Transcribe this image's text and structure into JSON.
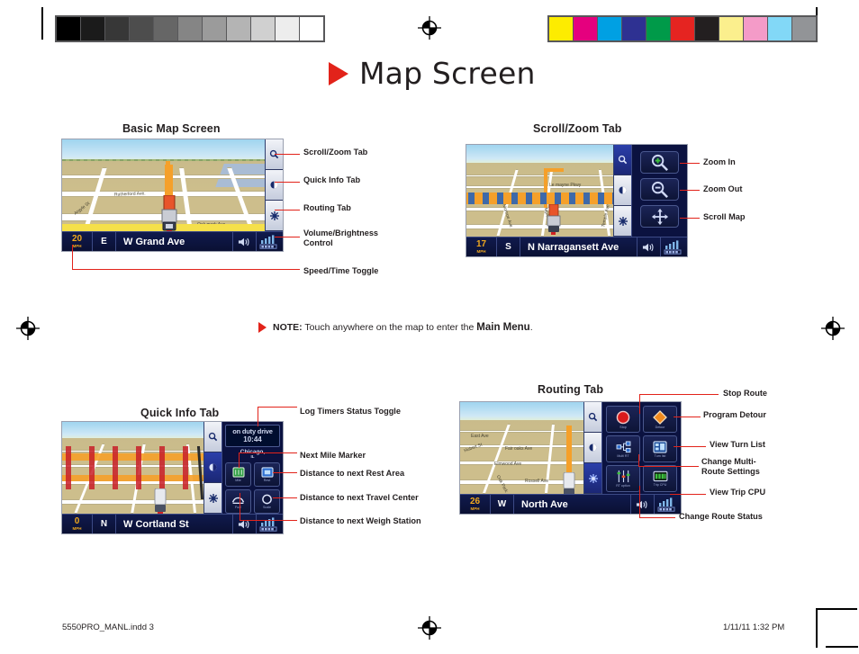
{
  "page": {
    "title": "Map Screen",
    "title_icon": "red-triangle-bullet"
  },
  "calibration": {
    "gray_label": "grayscale-calibration-strip",
    "gray_swatches": [
      "#000000",
      "#1b1b1b",
      "#373737",
      "#4d4d4d",
      "#666666",
      "#858585",
      "#9b9b9b",
      "#b4b4b4",
      "#d0d0d0",
      "#ededed",
      "#ffffff"
    ],
    "color_label": "color-calibration-strip",
    "color_swatches": [
      "#fdec00",
      "#e5007e",
      "#00a0e3",
      "#2e3192",
      "#009a49",
      "#e52421",
      "#231f20",
      "#fbef8d",
      "#f49bc8",
      "#82d8f7",
      "#929497"
    ]
  },
  "note": {
    "icon": "red-triangle-bullet",
    "label": "NOTE:",
    "text": " Touch anywhere on the map to enter the ",
    "emphasis": "Main Menu",
    "period": "."
  },
  "sections": {
    "basic": {
      "heading": "Basic Map Screen",
      "screen": {
        "speed": "20",
        "speed_unit": "MPH",
        "direction": "E",
        "street": "W Grand Ave",
        "road_labels": [
          "Rutherford Ave.",
          "Argyle St",
          "Oak mark Ave"
        ],
        "volume_icon": "speaker-icon",
        "signal_icon": "signal-bars-icon",
        "tabs": [
          {
            "name": "scroll-zoom-tab",
            "icon": "magnifier-icon",
            "active": false
          },
          {
            "name": "quick-info-tab",
            "icon": "info-circle-icon",
            "active": false
          },
          {
            "name": "routing-tab",
            "icon": "route-star-icon",
            "active": false
          }
        ]
      },
      "callouts": [
        {
          "id": "scroll-zoom-tab",
          "text": "Scroll/Zoom Tab"
        },
        {
          "id": "quick-info-tab",
          "text": "Quick Info Tab"
        },
        {
          "id": "routing-tab",
          "text": "Routing Tab"
        },
        {
          "id": "volume-brightness",
          "text": "Volume/Brightness Control"
        },
        {
          "id": "speed-time-toggle",
          "text": "Speed/Time Toggle"
        }
      ]
    },
    "scrollzoom": {
      "heading": "Scroll/Zoom Tab",
      "screen": {
        "speed": "17",
        "speed_unit": "MPH",
        "direction": "S",
        "street": "N Narragansett Ave",
        "road_labels": [
          "Le mayne Pkwy",
          "Monroe Ave",
          "Maple Ave",
          "Temple Ave",
          "Hilda"
        ],
        "volume_icon": "speaker-icon",
        "signal_icon": "signal-bars-icon",
        "tabs": [
          {
            "name": "scroll-zoom-tab",
            "icon": "magnifier-icon",
            "active": true
          },
          {
            "name": "quick-info-tab",
            "icon": "info-circle-icon",
            "active": false
          },
          {
            "name": "routing-tab",
            "icon": "route-star-icon",
            "active": false
          }
        ],
        "panel_buttons": [
          {
            "name": "zoom-in-button",
            "icon": "magnifier-plus-icon"
          },
          {
            "name": "zoom-out-button",
            "icon": "magnifier-minus-icon"
          },
          {
            "name": "scroll-map-button",
            "icon": "four-way-arrows-icon"
          }
        ]
      },
      "callouts": [
        {
          "id": "zoom-in",
          "text": "Zoom In"
        },
        {
          "id": "zoom-out",
          "text": "Zoom Out"
        },
        {
          "id": "scroll-map",
          "text": "Scroll Map"
        }
      ]
    },
    "quickinfo": {
      "heading": "Quick Info Tab",
      "screen": {
        "speed": "0",
        "speed_unit": "MPH",
        "direction": "N",
        "street": "W Cortland St",
        "volume_icon": "speaker-icon",
        "signal_icon": "signal-bars-icon",
        "readout_line1": "on duty drive",
        "readout_line2": "10:44",
        "city": "Chicago,",
        "state": "IL",
        "tabs": [
          {
            "name": "scroll-zoom-tab",
            "icon": "magnifier-icon",
            "active": false
          },
          {
            "name": "quick-info-tab",
            "icon": "info-circle-icon",
            "active": true
          },
          {
            "name": "routing-tab",
            "icon": "route-star-icon",
            "active": false
          }
        ],
        "panel_buttons": [
          {
            "name": "next-mile-marker-button",
            "icon": "mile-marker-icon",
            "caption": "Mile"
          },
          {
            "name": "rest-area-button",
            "icon": "rest-area-icon",
            "caption": "Rest"
          },
          {
            "name": "travel-center-button",
            "icon": "travel-center-icon",
            "caption": "Fuel"
          },
          {
            "name": "weigh-station-button",
            "icon": "weigh-station-icon",
            "caption": "Scale"
          }
        ]
      },
      "callouts": [
        {
          "id": "log-timers-status-toggle",
          "text": "Log Timers Status Toggle"
        },
        {
          "id": "next-mile-marker",
          "text": "Next Mile Marker"
        },
        {
          "id": "distance-rest-area",
          "text": "Distance to next Rest Area"
        },
        {
          "id": "distance-travel-center",
          "text": "Distance to next Travel Center"
        },
        {
          "id": "distance-weigh-station",
          "text": "Distance to next Weigh Station"
        }
      ]
    },
    "routing": {
      "heading": "Routing Tab",
      "screen": {
        "speed": "26",
        "speed_unit": "MPH",
        "direction": "W",
        "street": "North Ave",
        "road_labels": [
          "East Ave",
          "Fair oaks Ave",
          "Elmwood Ave",
          "Rossell Ave",
          "Hubert St",
          "Oak Park"
        ],
        "volume_icon": "speaker-icon",
        "signal_icon": "signal-bars-icon",
        "tabs": [
          {
            "name": "scroll-zoom-tab",
            "icon": "magnifier-icon",
            "active": false
          },
          {
            "name": "quick-info-tab",
            "icon": "info-circle-icon",
            "active": false
          },
          {
            "name": "routing-tab",
            "icon": "route-star-icon",
            "active": true
          }
        ],
        "panel_buttons": [
          {
            "name": "stop-route-button",
            "icon": "red-stop-circle-icon",
            "caption": "Stop"
          },
          {
            "name": "detour-button",
            "icon": "orange-diamond-icon",
            "caption": "Detour"
          },
          {
            "name": "multi-route-button",
            "icon": "multi-route-icon",
            "caption": "Multi RT"
          },
          {
            "name": "turn-list-button",
            "icon": "turn-list-icon",
            "caption": "Turn list"
          },
          {
            "name": "route-options-button",
            "icon": "sliders-icon",
            "caption": "RT option"
          },
          {
            "name": "trip-cpu-button",
            "icon": "trip-cpu-icon",
            "caption": "Trip CPU"
          }
        ]
      },
      "callouts": [
        {
          "id": "stop-route",
          "text": "Stop Route"
        },
        {
          "id": "program-detour",
          "text": "Program Detour"
        },
        {
          "id": "view-turn-list",
          "text": "View Turn List"
        },
        {
          "id": "change-multi-route",
          "text": "Change Multi-Route Settings"
        },
        {
          "id": "view-trip-cpu",
          "text": "View Trip CPU"
        },
        {
          "id": "change-route-status",
          "text": "Change Route Status"
        }
      ]
    }
  },
  "footer": {
    "file": "5550PRO_MANL.indd   3",
    "timestamp": "1/11/11   1:32 PM",
    "reg_icon": "registration-target-icon"
  },
  "colors": {
    "accent_red": "#e2231a",
    "ink": "#231f20",
    "device_navy": "#0b1240",
    "speed_amber": "#f0a81e"
  }
}
